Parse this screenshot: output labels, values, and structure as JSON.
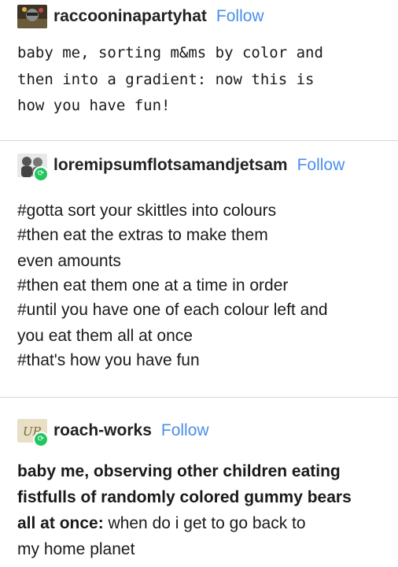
{
  "posts": [
    {
      "username": "raccooninapartyhat",
      "follow_label": "Follow",
      "avatar_icon": "raccoon-avatar",
      "lines": [
        {
          "a": "baby me, sorting m&ms by color and",
          "b": ""
        },
        {
          "a": "then into a gradient:",
          "b": " now this is"
        },
        {
          "a": "",
          "b": "how you have fun!"
        }
      ]
    },
    {
      "username": "loremipsumflotsamandjetsam",
      "follow_label": "Follow",
      "avatar_icon": "people-avatar",
      "badge_icon": "reblog-icon",
      "lines": [
        "#gotta sort your skittles into colours",
        "#then eat the extras to make them",
        "even amounts",
        "#then eat them one at a time in order",
        "#until you have one of each colour left and",
        "you eat them all at once",
        "#that's how you have fun"
      ]
    },
    {
      "username": "roach-works",
      "follow_label": "Follow",
      "avatar_icon": "logo-avatar",
      "badge_icon": "reblog-icon",
      "lines": [
        {
          "a": "baby me, observing other children eating",
          "b": ""
        },
        {
          "a": "fistfulls of randomly colored gummy bears",
          "b": ""
        },
        {
          "a": "all at once:",
          "b": " when do i get to go back to"
        },
        {
          "a": "",
          "b": "my home planet"
        }
      ]
    }
  ],
  "colors": {
    "follow": "#4a8fe7",
    "badge": "#22c55e",
    "divider": "#d6d6d6"
  }
}
